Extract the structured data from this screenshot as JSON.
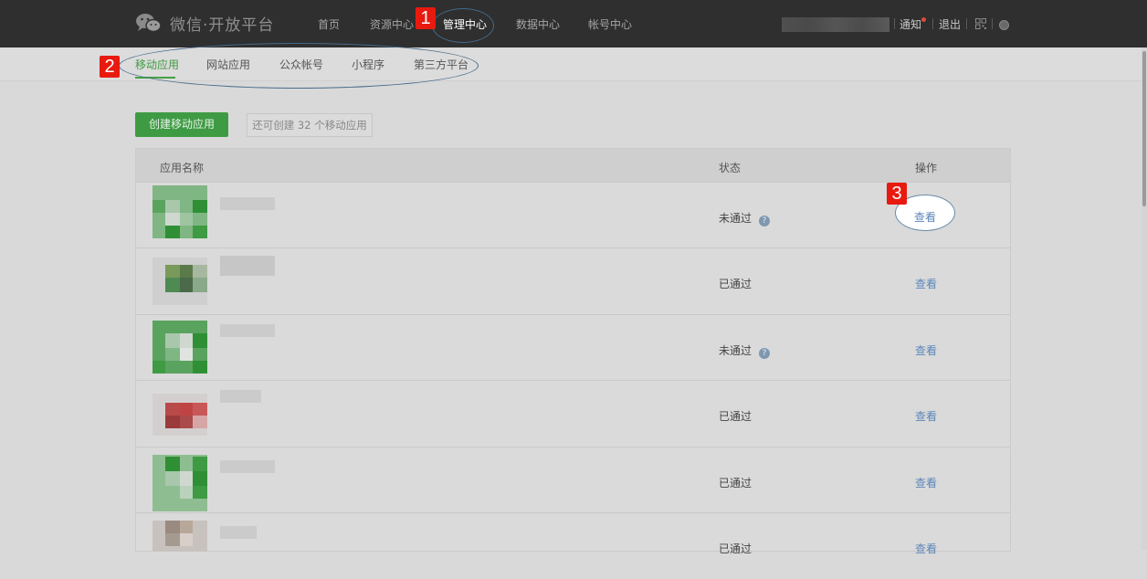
{
  "header": {
    "brand": "微信·开放平台",
    "nav": [
      "首页",
      "资源中心",
      "管理中心",
      "数据中心",
      "帐号中心"
    ],
    "active_nav": "管理中心",
    "notify_label": "通知",
    "logout_label": "退出"
  },
  "subnav": {
    "tabs": [
      "移动应用",
      "网站应用",
      "公众帐号",
      "小程序",
      "第三方平台"
    ],
    "active_tab": "移动应用"
  },
  "toolbar": {
    "create_label": "创建移动应用",
    "quota_text": "还可创建 32 个移动应用"
  },
  "table": {
    "headers": [
      "应用名称",
      "状态",
      "操作"
    ],
    "rows": [
      {
        "status": "未通过",
        "help": "?",
        "action": "查看"
      },
      {
        "status": "已通过",
        "action": "查看"
      },
      {
        "status": "未通过",
        "help": "?",
        "action": "查看"
      },
      {
        "status": "已通过",
        "action": "查看"
      },
      {
        "status": "已通过",
        "action": "查看"
      },
      {
        "status": "已通过",
        "action": "查看"
      }
    ]
  },
  "annotations": [
    "1",
    "2",
    "3"
  ],
  "colors": {
    "accent": "#3e9b43",
    "link": "#5c86b8",
    "marker": "#e8190f",
    "topbar": "#2f2f2f"
  }
}
